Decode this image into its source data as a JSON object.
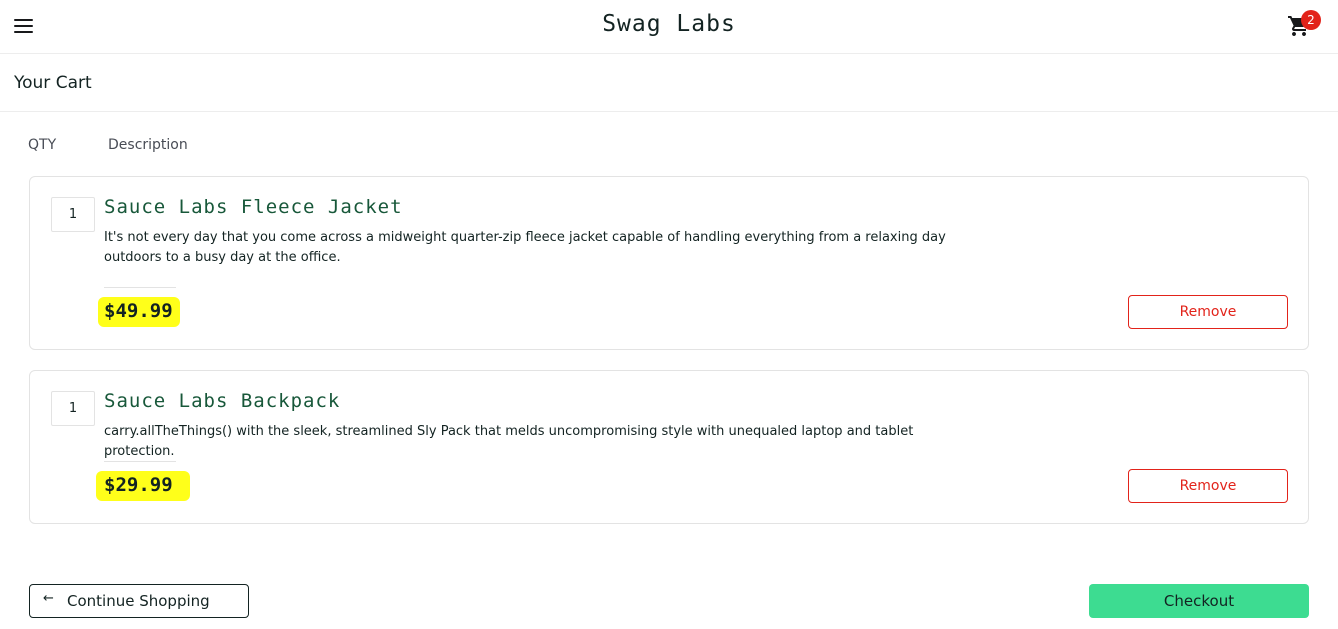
{
  "header": {
    "title": "Swag Labs",
    "menu_icon": "hamburger-menu-icon",
    "cart_icon": "shopping-cart-icon",
    "cart_count": "2"
  },
  "page": {
    "title": "Your Cart",
    "qty_header": "QTY",
    "desc_header": "Description"
  },
  "items": [
    {
      "qty": "1",
      "name": "Sauce Labs Fleece Jacket",
      "description": "It's not every day that you come across a midweight quarter-zip fleece jacket capable of handling everything from a relaxing day outdoors to a busy day at the office.",
      "price": "$49.99",
      "remove_label": "Remove"
    },
    {
      "qty": "1",
      "name": "Sauce Labs Backpack",
      "description": "carry.allTheThings() with the sleek, streamlined Sly Pack that melds uncompromising style with unequaled laptop and tablet protection.",
      "price": "$29.99",
      "remove_label": "Remove"
    }
  ],
  "footer": {
    "continue_icon": "arrow-left-icon",
    "continue_label": "Continue Shopping",
    "checkout_label": "Checkout"
  },
  "colors": {
    "accent_green": "#3ddc91",
    "item_name_green": "#18583a",
    "remove_red": "#e2231a",
    "price_highlight": "#ffff1a"
  }
}
